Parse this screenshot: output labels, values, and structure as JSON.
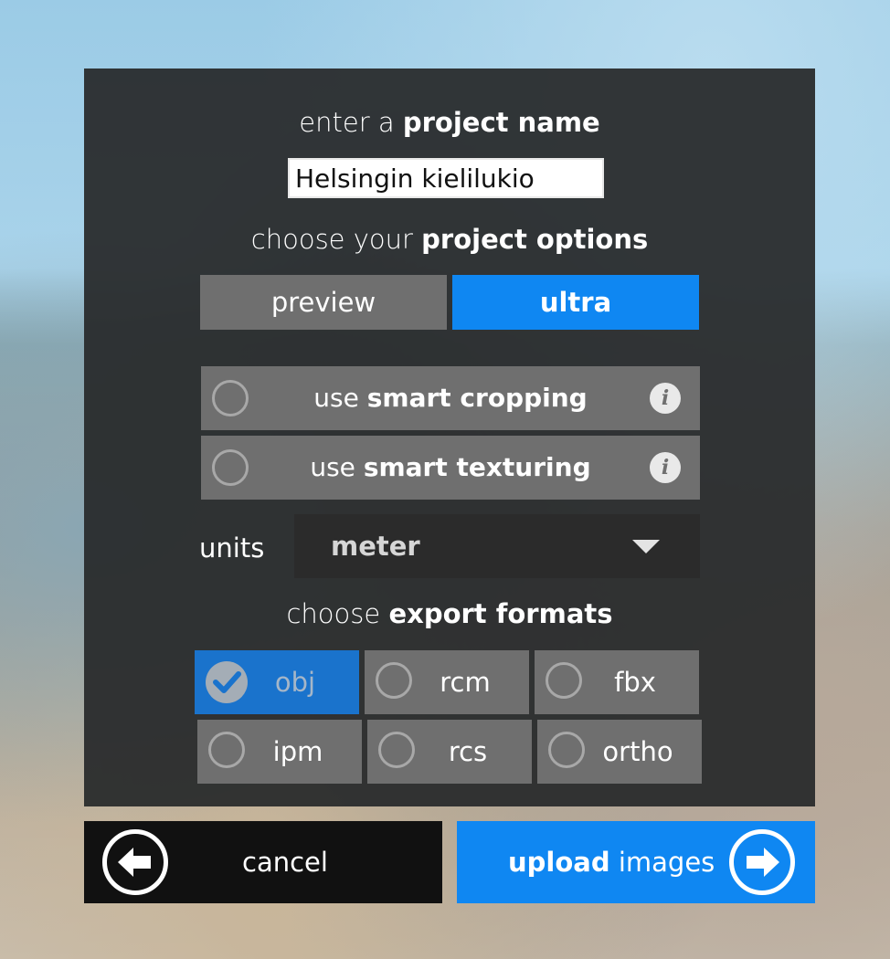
{
  "project_name": {
    "label_prefix": "enter a",
    "label_bold": "project name",
    "value": "Helsingin kielilukio"
  },
  "options": {
    "label_prefix": "choose your",
    "label_bold": "project options",
    "modes": [
      {
        "label": "preview",
        "selected": false
      },
      {
        "label": "ultra",
        "selected": true
      }
    ],
    "toggles": [
      {
        "prefix": "use",
        "bold": "smart cropping",
        "checked": false,
        "info_icon": "info-icon"
      },
      {
        "prefix": "use",
        "bold": "smart texturing",
        "checked": false,
        "info_icon": "info-icon"
      }
    ]
  },
  "units": {
    "label": "units",
    "selected": "meter"
  },
  "export": {
    "label_prefix": "choose",
    "label_bold": "export formats",
    "formats": [
      {
        "label": "obj",
        "checked": true
      },
      {
        "label": "rcm",
        "checked": false
      },
      {
        "label": "fbx",
        "checked": false
      },
      {
        "label": "ipm",
        "checked": false
      },
      {
        "label": "rcs",
        "checked": false
      },
      {
        "label": "ortho",
        "checked": false
      }
    ]
  },
  "actions": {
    "cancel_label": "cancel",
    "upload_bold": "upload",
    "upload_rest": "images"
  },
  "colors": {
    "accent": "#0f87f2",
    "panel": "#282a2c",
    "option_bg": "#6f6f6f"
  },
  "icons": {
    "cancel": "arrow-left-circle-icon",
    "upload": "arrow-right-circle-icon",
    "checked": "check-circle-icon",
    "dropdown": "caret-down-icon"
  }
}
